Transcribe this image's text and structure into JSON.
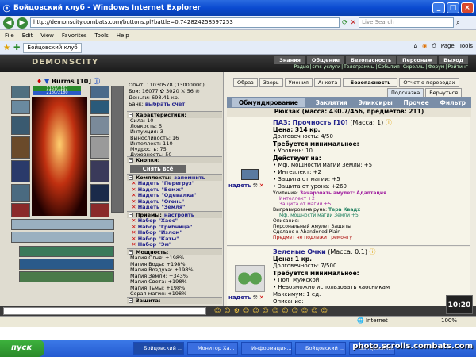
{
  "window": {
    "title": "Бойцовский клуб - Windows Internet Explorer"
  },
  "address": {
    "url": "http://demonscity.combats.com/buttons.pl?battle=0.742824258597253",
    "search_placeholder": "Live Search"
  },
  "menu": [
    "File",
    "Edit",
    "View",
    "Favorites",
    "Tools",
    "Help"
  ],
  "favbar": {
    "tab_label": "Бойцовский клуб",
    "page_label": "Page",
    "tools_label": "Tools"
  },
  "game": {
    "logo": "DEMONSCITY",
    "nav_top": [
      "Знания",
      "Общение",
      "Безопасность",
      "Персонаж",
      "Выход"
    ],
    "nav_bottom": [
      "Радио",
      "sms-услуги",
      "Телеграммы",
      "События",
      "Скроллы",
      "Форум",
      "Рейтинг"
    ]
  },
  "character": {
    "name": "Burms",
    "level": "[10]",
    "hp": "1167/1167",
    "mp": "2180/2180",
    "exp_line": "Опыт: 11030578 (13000000)",
    "fights_line": "Бои: 16077 ✿ 3020 ⚔ 56 ☠",
    "money_line": "Деньги: 698.41 кр.",
    "bank_label": "Банк:",
    "bank_link": "выбрать счёт",
    "attrs_header": "Характеристики:",
    "attrs": [
      "Сила: 10",
      "Ловкость: 5",
      "Интуиция: 3",
      "Выносливость: 16",
      "Интеллект: 110",
      "Мудрость: 75",
      "Духовность: 50"
    ],
    "buttons_header": "Кнопки:",
    "remove_all": "Снять всё",
    "sets_header": "Комплекты:",
    "sets_remember": "запомнить",
    "sets": [
      "Надеть \"Перегруз\"",
      "Надеть \"Бомж\"",
      "Надеть \"Одевалка\"",
      "Надеть \"Огонь\"",
      "Надеть \"Земля\""
    ],
    "tricks_header": "Приемы:",
    "tricks_setup": "настроить",
    "tricks": [
      "Набор \"Хаос\"",
      "Набор \"Грибница\"",
      "Набор \"Излом\"",
      "Набор \"Каты\"",
      "Набор \"Эм\""
    ],
    "powers_header": "Мощность:",
    "powers": [
      "Магия Огня: +198%",
      "Магия Воды: +198%",
      "Магия Воздуха: +198%",
      "Магия Земли: +343%",
      "Магия Света: +198%",
      "Магия Тьмы: +198%",
      "Серая магия: +198%"
    ],
    "protect_header": "Защита:"
  },
  "actions": {
    "buttons": [
      "Образ",
      "Зверь",
      "Умения",
      "Анкета",
      "Безопасность",
      "Отчет о переводах"
    ],
    "hint": "Подсказка",
    "back": "Вернуться"
  },
  "inventory": {
    "tabs": [
      "Обмундирование",
      "Заклятия",
      "Эликсиры",
      "Прочее",
      "Фильтр"
    ],
    "header": "Рюкзак (масса: 430.7/456, предметов: 211)",
    "wear_label": "надеть",
    "items": [
      {
        "title": "ПАЗ: Прочность [10]",
        "mass": "(Масса: 1)",
        "lines": [
          "Цена: 314 кр.",
          "Долговечность: 4/50",
          "Требуется минимальное:",
          "• Уровень: 10",
          "Действует на:",
          "• Мф. мощности магии Земли: +5",
          "• Интеллект: +2",
          "• Защита от магии: +5",
          "• Защита от урона: +260"
        ],
        "upgrade_label": "Усиление:",
        "upgrade_link": "Зачаровать амулет: Адаптация",
        "upgrade_lines": [
          "Интеллект +2",
          "Защита от магии +5"
        ],
        "rune_label": "Выгравирована руна:",
        "rune_link": "Тера Квадх",
        "rune_line": "Мф. мощности магии Земли +5",
        "tail": [
          "Описание:",
          "Персональный Амулет Защиты",
          "Сделано в Abandoned Plain",
          "Предмет не подлежит ремонту"
        ]
      },
      {
        "title": "Зеленые Очки",
        "mass": "(Масса: 0.1)",
        "lines": [
          "Цена: 1 кр.",
          "Долговечность: 7/500",
          "Требуется минимальное:",
          "• Пол: Мужской",
          "• Невозможно использовать хаосникам",
          "Максимум: 1 ед.",
          "Описание:"
        ]
      }
    ]
  },
  "clock": "10:20",
  "status": {
    "zone": "Internet",
    "zoom": "100%"
  },
  "taskbar": {
    "start": "пуск",
    "buttons": [
      "Бойцовский ...",
      "Монитор Ха...",
      "Информация...",
      "Бойцовский ...",
      "Бойцовский..."
    ],
    "watermark": "photo.scrolls.combats.com"
  },
  "colors": {
    "titlebar": "#0a4ad0",
    "game_header": "#2a2a2a",
    "link": "#23238c",
    "tab_bar": "#7a8ea8"
  }
}
